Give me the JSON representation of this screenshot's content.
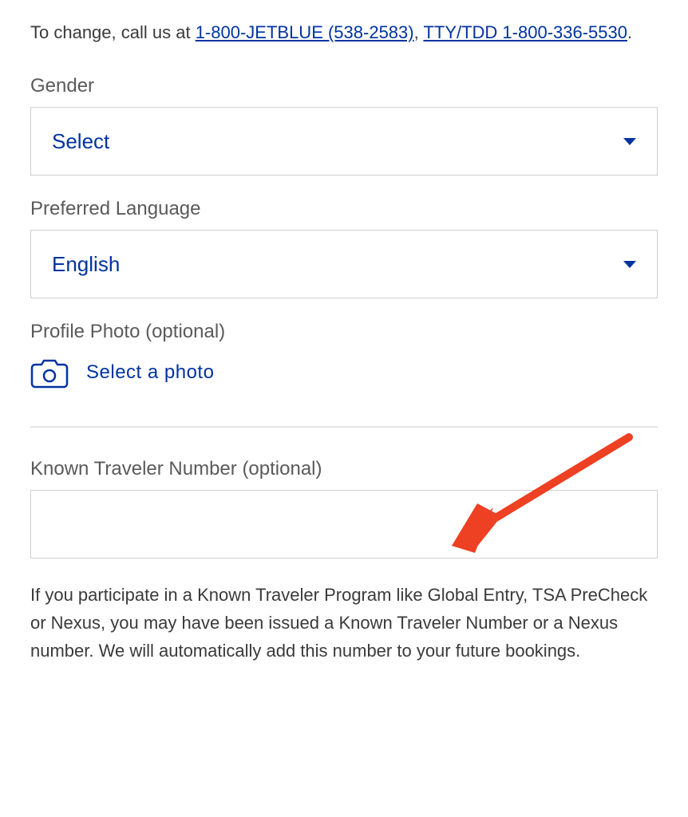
{
  "instruction": {
    "prefix": "To change, call us at ",
    "link1": "1-800-JETBLUE (538-2583)",
    "separator": ", ",
    "link2": "TTY/TDD 1-800-336-5530",
    "suffix": "."
  },
  "gender": {
    "label": "Gender",
    "value": "Select"
  },
  "language": {
    "label": "Preferred Language",
    "value": "English"
  },
  "photo": {
    "label": "Profile Photo (optional)",
    "action": "Select a photo"
  },
  "ktn": {
    "label": "Known Traveler Number (optional)",
    "value": "",
    "help": "If you participate in a Known Traveler Program like Global Entry, TSA PreCheck or Nexus, you may have been issued a Known Traveler Number or a Nexus number. We will automatically add this number to your future bookings."
  }
}
